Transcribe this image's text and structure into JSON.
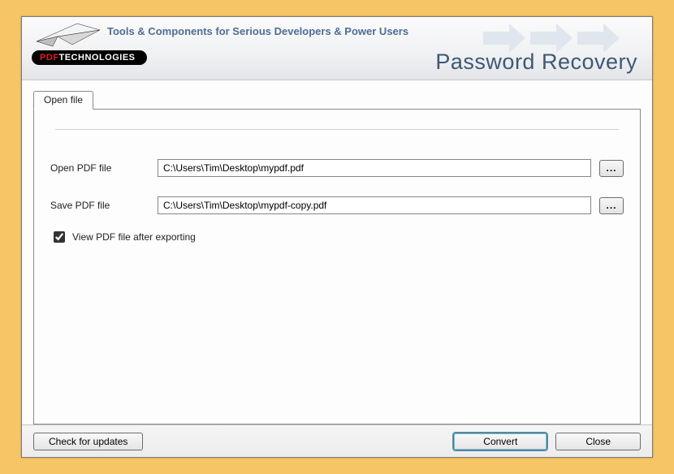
{
  "header": {
    "tagline": "Tools & Components for Serious Developers & Power Users",
    "app_title": "Password Recovery",
    "logo_pdf": "PDF",
    "logo_tech": "TECHNOLOGIES"
  },
  "tabs": {
    "open_file": "Open file"
  },
  "form": {
    "open_label": "Open PDF file",
    "open_value": "C:\\Users\\Tim\\Desktop\\mypdf.pdf",
    "save_label": "Save PDF file",
    "save_value": "C:\\Users\\Tim\\Desktop\\mypdf-copy.pdf",
    "browse_label": "...",
    "view_after_label": "View PDF file after exporting",
    "view_after_checked": true
  },
  "footer": {
    "check_updates": "Check for updates",
    "convert": "Convert",
    "close": "Close"
  }
}
